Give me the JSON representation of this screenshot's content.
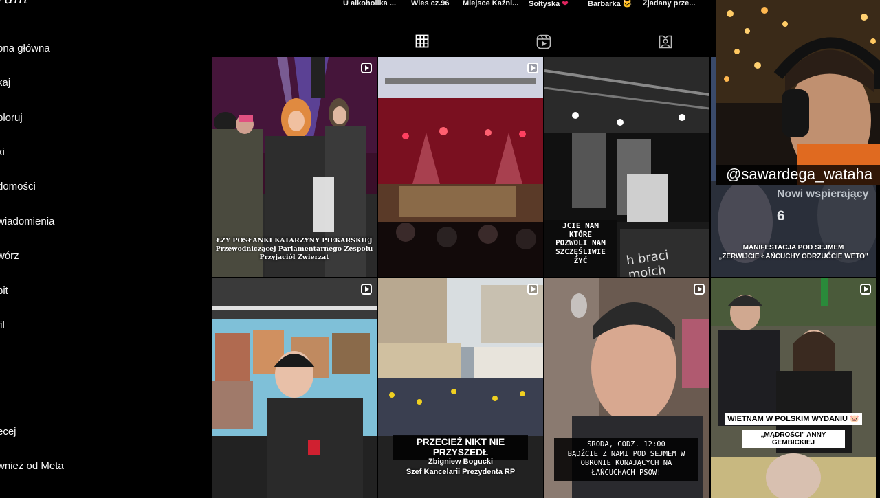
{
  "app": {
    "logo_text": "ram"
  },
  "sidebar": {
    "items": [
      {
        "label": "ona główna"
      },
      {
        "label": "kaj"
      },
      {
        "label": "ploruj"
      },
      {
        "label": "ki"
      },
      {
        "label": "domości"
      },
      {
        "label": "wiadomienia"
      },
      {
        "label": "wórz"
      },
      {
        "label": "pit"
      },
      {
        "label": "fil"
      },
      {
        "label": "ecej"
      },
      {
        "label": "wnież od Meta"
      }
    ]
  },
  "highlights": [
    {
      "label": "U alkoholika ..."
    },
    {
      "label": "Wies cz.96"
    },
    {
      "label": "Miejsce Kaźni..."
    },
    {
      "label": "Sołtyska",
      "emoji": "❤"
    },
    {
      "label": "Barbarka",
      "emoji": "🐱"
    },
    {
      "label": "Zjadany prze..."
    }
  ],
  "tabs": [
    {
      "name": "posts",
      "icon": "grid-icon",
      "active": true
    },
    {
      "name": "reels",
      "icon": "reels-icon",
      "active": false
    },
    {
      "name": "tagged",
      "icon": "tagged-icon",
      "active": false
    }
  ],
  "posts": [
    {
      "caption_lines": [
        "ŁZY POSŁANKI KATARZYNY PIEKARSKIEJ",
        "Przewodniczącej Parlamentarnego Zespołu",
        "Przyjaciół Zwierząt"
      ]
    },
    {
      "caption_lines": []
    },
    {
      "sign_lines": [
        "JCIE NAM",
        "KTÓRE",
        "POZWOLI NAM",
        "SZCZĘŚLIWIE",
        "ŻYĆ"
      ],
      "banner_text": "h braci moich"
    },
    {
      "caption_lines": [
        "MANIFESTACJA POD SEJMEM",
        "„ZERWIJCIE ŁAŃCUCHY ODRZUĆCIE WETO\""
      ]
    },
    {
      "caption_lines": []
    },
    {
      "headline": "PRZECIEŻ NIKT NIE PRZYSZEDŁ",
      "caption_lines": [
        "Zbigniew Bogucki",
        "Szef Kancelarii Prezydenta RP"
      ]
    },
    {
      "caption_lines": [
        "ŚRODA, GODZ. 12:00",
        "BĄDŹCIE Z NAMI POD SEJMEM W",
        "OBRONIE KONAJĄCYCH NA",
        "ŁAŃCUCHACH PSÓW!"
      ]
    },
    {
      "caption_lines": [
        "WIETNAM W POLSKIM WYDANIU",
        "„MĄDROŚCI\" ANNY GEMBICKIEJ"
      ],
      "emoji": "🐷"
    }
  ],
  "stream": {
    "handle": "@sawardega_wataha",
    "supporters_label": "Nowi wspierający",
    "supporters_count": "6"
  }
}
